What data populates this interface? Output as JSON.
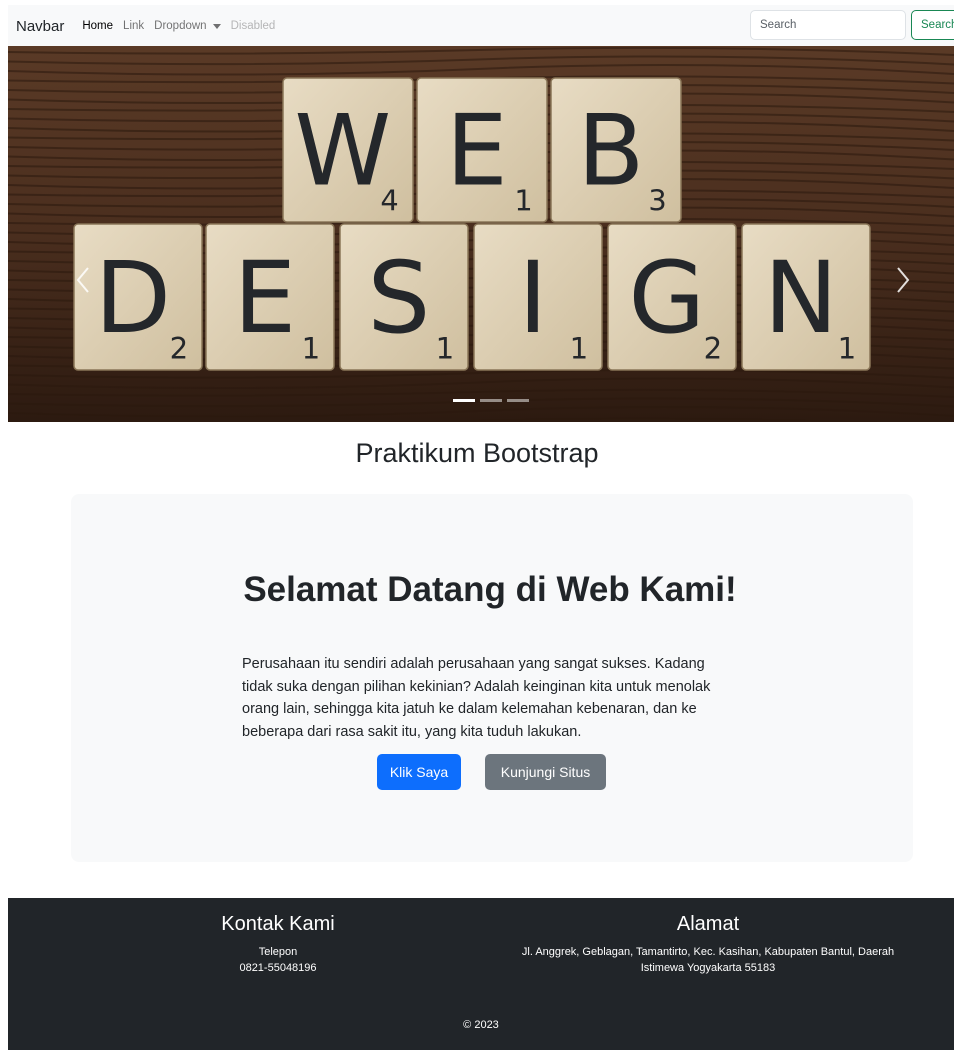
{
  "navbar": {
    "brand": "Navbar",
    "links": [
      "Home",
      "Link",
      "Dropdown",
      "Disabled"
    ],
    "search_placeholder": "Search",
    "search_button": "Search"
  },
  "carousel": {
    "row1_letters": [
      {
        "letter": "W",
        "score": "4"
      },
      {
        "letter": "E",
        "score": "1"
      },
      {
        "letter": "B",
        "score": "3"
      }
    ],
    "row2_letters": [
      {
        "letter": "D",
        "score": "2"
      },
      {
        "letter": "E",
        "score": "1"
      },
      {
        "letter": "S",
        "score": "1"
      },
      {
        "letter": "I",
        "score": "1"
      },
      {
        "letter": "G",
        "score": "2"
      },
      {
        "letter": "N",
        "score": "1"
      }
    ],
    "slide_count": 3,
    "active_slide": 1
  },
  "main": {
    "title": "Praktikum Bootstrap"
  },
  "jumbotron": {
    "heading": "Selamat Datang di Web Kami!",
    "text": "Perusahaan itu sendiri adalah perusahaan yang sangat sukses. Kadang tidak suka dengan pilihan kekinian? Adalah keinginan kita untuk menolak orang lain, sehingga kita jatuh ke dalam kelemahan kebenaran, dan ke beberapa dari rasa sakit itu, yang kita tuduh lakukan.",
    "primary_button": "Klik Saya",
    "secondary_button": "Kunjungi Situs"
  },
  "footer": {
    "contact_heading": "Kontak Kami",
    "phone_label": "Telepon",
    "phone_number": "0821-55048196",
    "address_heading": "Alamat",
    "address": "Jl. Anggrek, Geblagan, Tamantirto, Kec. Kasihan, Kabupaten Bantul, Daerah Istimewa Yogyakarta 55183",
    "copyright": "© 2023"
  },
  "colors": {
    "primary": "#0d6efd",
    "secondary": "#6c757d",
    "success": "#198754",
    "dark": "#212529",
    "light": "#f8f9fa"
  }
}
